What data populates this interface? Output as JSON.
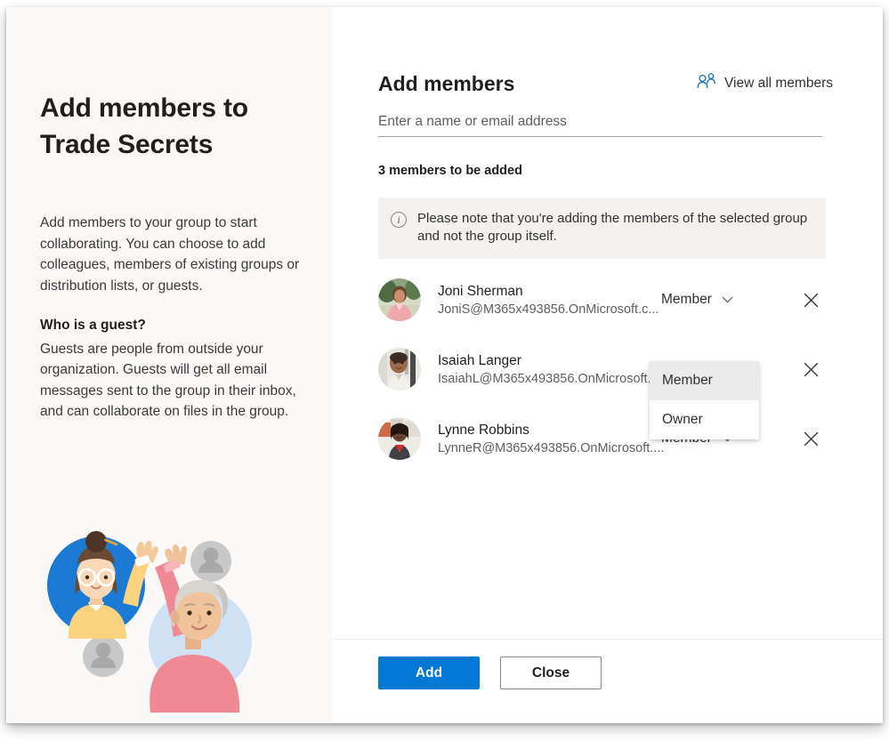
{
  "left_panel": {
    "title": "Add members to Trade Secrets",
    "paragraph_1": "Add members to your group to start collaborating. You can choose to add colleagues, members of existing groups or distribution lists, or guests.",
    "subhead": "Who is a guest?",
    "paragraph_2": "Guests are people from outside your organization. Guests will get all email messages sent to the group in their inbox, and can collaborate on files in the group.",
    "illustration_name": "two-people-high-five-illustration"
  },
  "right_panel": {
    "title": "Add members",
    "view_all_members_label": "View all members",
    "view_all_members_icon": "people-add-icon",
    "search": {
      "placeholder": "Enter a name or email address",
      "value": ""
    },
    "count_label": "3 members to be added",
    "info_banner": {
      "icon": "info-circle-icon",
      "text": "Please note that you're adding the members of the selected group and not the group itself."
    },
    "members": [
      {
        "name": "Joni Sherman",
        "email": "JoniS@M365x493856.OnMicrosoft.c...",
        "role": "Member",
        "avatar": "joni-sherman-avatar"
      },
      {
        "name": "Isaiah Langer",
        "email": "IsaiahL@M365x493856.OnMicrosoft....",
        "role": "Member",
        "avatar": "isaiah-langer-avatar"
      },
      {
        "name": "Lynne Robbins",
        "email": "LynneR@M365x493856.OnMicrosoft....",
        "role": "Member",
        "avatar": "lynne-robbins-avatar"
      }
    ],
    "role_dropdown": {
      "open_for_member_index": 1,
      "options": [
        "Member",
        "Owner"
      ],
      "selected": "Member"
    },
    "footer": {
      "primary_label": "Add",
      "secondary_label": "Close"
    }
  },
  "colors": {
    "accent": "#0078d4",
    "link": "#0f6cbd",
    "left_panel_bg": "#faf9f8",
    "banner_bg": "#f3f2f1",
    "dropdown_selected_bg": "#ebebeb"
  }
}
